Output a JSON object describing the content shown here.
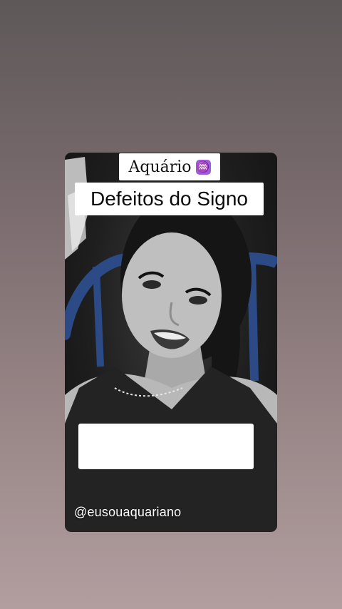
{
  "overlay": {
    "sign_title": "Aquário",
    "sign_icon": "aquarius-symbol-icon",
    "sign_icon_glyph": "♒",
    "subtitle": "Defeitos do Signo",
    "handle": "@eusouaquariano"
  },
  "colors": {
    "background_top": "#5e5859",
    "background_bottom": "#b29e9f",
    "sign_icon_bg": "#9c5bd8",
    "chip_bg": "#ffffff"
  }
}
